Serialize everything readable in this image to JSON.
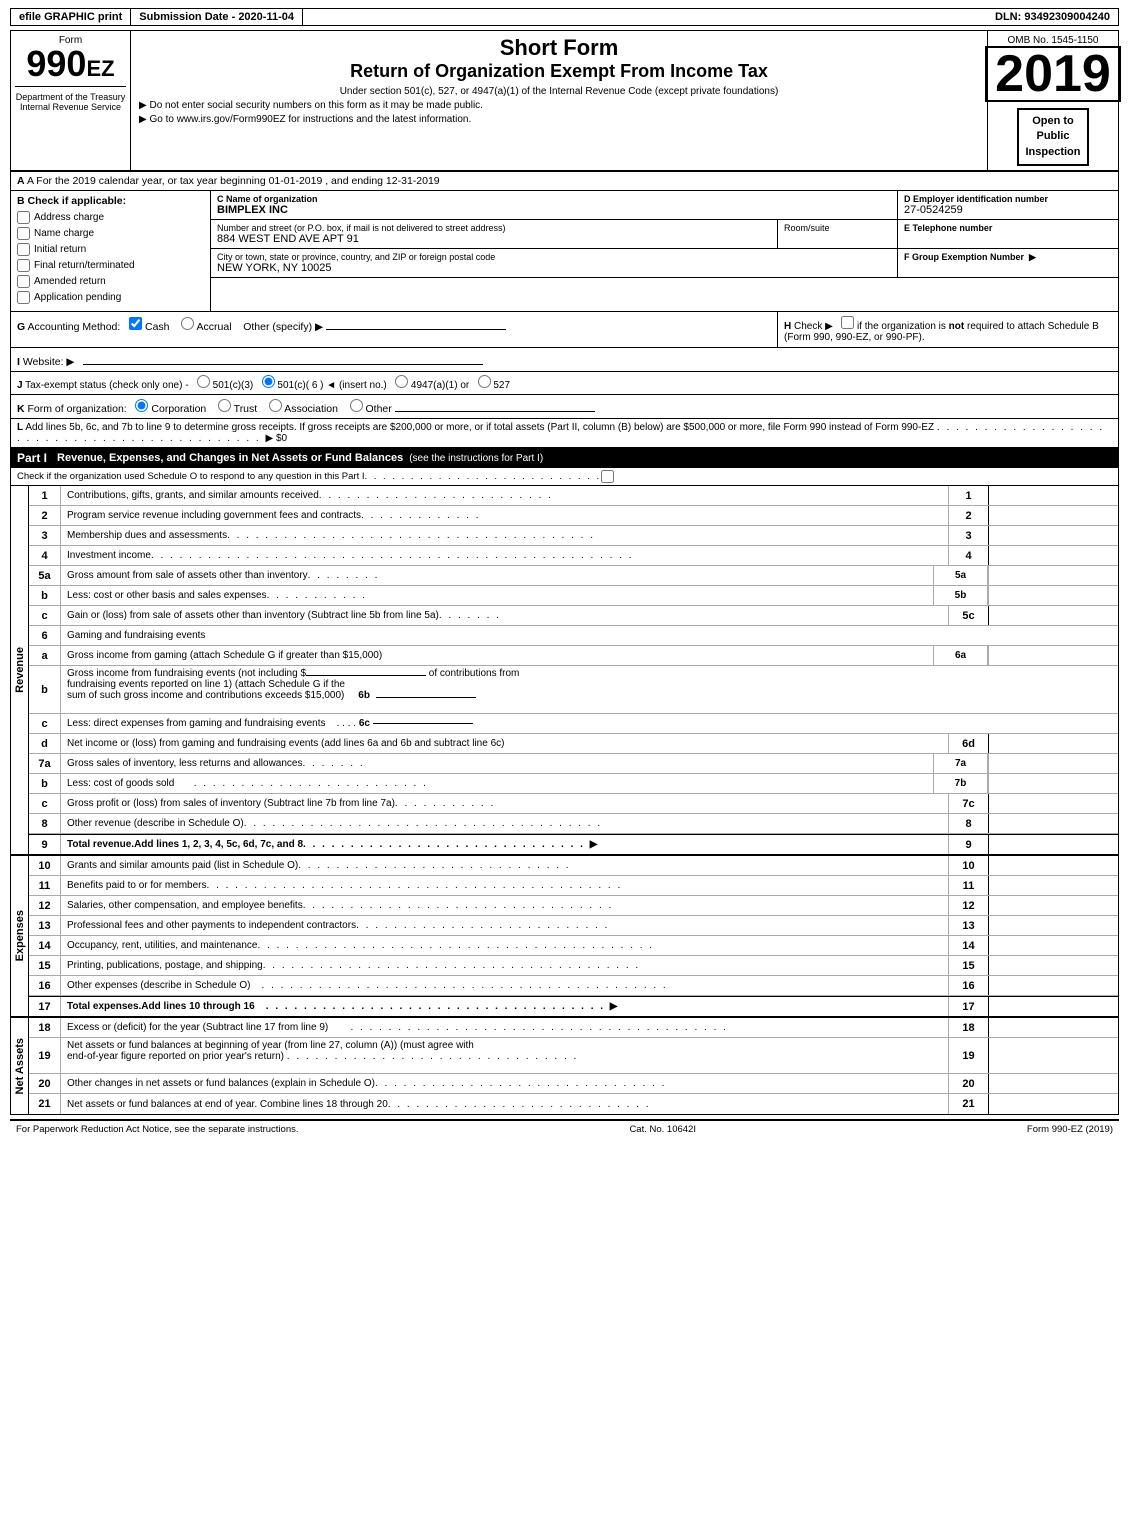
{
  "topBar": {
    "efile": "efile GRAPHIC print",
    "submission": "Submission Date - 2020-11-04",
    "dln": "DLN: 93492309004240"
  },
  "header": {
    "formLabel": "Form",
    "formNumber": "990",
    "formEZ": "EZ",
    "shortForm": "Short Form",
    "returnTitle": "Return of Organization Exempt From Income Tax",
    "underSection": "Under section 501(c), 527, or 4947(a)(1) of the Internal Revenue Code (except private foundations)",
    "doNotEnter": "▶ Do not enter social security numbers on this form as it may be made public.",
    "goTo": "▶ Go to www.irs.gov/Form990EZ for instructions and the latest information.",
    "ombNo": "OMB No. 1545-1150",
    "year": "2019",
    "openToPublic": "Open to\nPublic\nInspection"
  },
  "sectionA": {
    "text": "A For the 2019 calendar year, or tax year beginning 01-01-2019 , and ending 12-31-2019"
  },
  "sectionB": {
    "label": "B Check if applicable:",
    "checkboxes": [
      {
        "id": "address-change",
        "label": "Address change",
        "checked": false
      },
      {
        "id": "name-change",
        "label": "Name change",
        "checked": false
      },
      {
        "id": "initial-return",
        "label": "Initial return",
        "checked": false
      },
      {
        "id": "final-return",
        "label": "Final return/terminated",
        "checked": false
      },
      {
        "id": "amended-return",
        "label": "Amended return",
        "checked": false
      },
      {
        "id": "application-pending",
        "label": "Application pending",
        "checked": false
      }
    ]
  },
  "sectionC": {
    "label": "C Name of organization",
    "value": "BIMPLEX INC"
  },
  "sectionD": {
    "label": "D Employer identification number",
    "value": "27-0524259"
  },
  "sectionStreet": {
    "label": "Number and street (or P.O. box, if mail is not delivered to street address)",
    "value": "884 WEST END AVE APT 91",
    "roomLabel": "Room/suite",
    "roomValue": ""
  },
  "sectionE": {
    "label": "E Telephone number",
    "value": ""
  },
  "sectionCity": {
    "label": "City or town, state or province, country, and ZIP or foreign postal code",
    "value": "NEW YORK, NY  10025"
  },
  "sectionF": {
    "label": "F Group Exemption Number",
    "arrowLabel": "▶",
    "value": ""
  },
  "sectionG": {
    "label": "G Accounting Method:",
    "cashLabel": "☑ Cash",
    "accrualLabel": "○ Accrual",
    "otherLabel": "Other (specify) ▶",
    "underline": ""
  },
  "sectionH": {
    "label": "H Check ▶",
    "text": "○ if the organization is not required to attach Schedule B (Form 990, 990-EZ, or 990-PF)."
  },
  "sectionI": {
    "label": "I Website: ▶",
    "value": ""
  },
  "sectionJ": {
    "label": "J Tax-exempt status (check only one) -",
    "options": "○ 501(c)(3)  ☑ 501(c)( 6 )  ◄ (insert no.)  ○ 4947(a)(1) or  ○ 527"
  },
  "sectionK": {
    "label": "K Form of organization:",
    "options": "☑ Corporation   ○ Trust   ○ Association   ○ Other"
  },
  "sectionL": {
    "text": "L Add lines 5b, 6c, and 7b to line 9 to determine gross receipts. If gross receipts are $200,000 or more, or if total assets (Part II, column (B) below) are $500,000 or more, file Form 990 instead of Form 990-EZ",
    "dots": ". . . . . . . . . . . . . . . . . . . . . . . . . . . . . . . . . . . . . . . . . . . ▶ $0"
  },
  "partI": {
    "label": "Part I",
    "title": "Revenue, Expenses, and Changes in Net Assets or Fund Balances",
    "seeInstructions": "(see the instructions for Part I)",
    "checkSchedule": "Check if the organization used Schedule O to respond to any question in this Part I",
    "checkDots": ". . . . . . . . . . . . . . . . . . . . . . . . . . ○",
    "revenueSideLabel": "Revenue",
    "lines": [
      {
        "num": "1",
        "desc": "Contributions, gifts, grants, and similar amounts received",
        "dots": ". . . . . . . . . . . . . . . . . . . . . . . . .",
        "ref": "",
        "lineNum": "1",
        "bold": false
      },
      {
        "num": "2",
        "desc": "Program service revenue including government fees and contracts",
        "dots": ". . . . . . . . . . . . . .",
        "ref": "",
        "lineNum": "2",
        "bold": false
      },
      {
        "num": "3",
        "desc": "Membership dues and assessments",
        "dots": ". . . . . . . . . . . . . . . . . . . . . . . . . . . . . . . . . . . . . . .",
        "ref": "",
        "lineNum": "3",
        "bold": false
      },
      {
        "num": "4",
        "desc": "Investment income",
        "dots": ". . . . . . . . . . . . . . . . . . . . . . . . . . . . . . . . . . . . . . . . . . . . . . . . . . .",
        "ref": "",
        "lineNum": "4",
        "bold": false
      },
      {
        "num": "5a",
        "desc": "Gross amount from sale of assets other than inventory",
        "dots": ". . . . . . . .",
        "ref": "5a",
        "lineNum": "",
        "bold": false
      },
      {
        "num": "b",
        "desc": "Less: cost or other basis and sales expenses",
        "dots": ". . . . . . . . . . .",
        "ref": "5b",
        "lineNum": "",
        "bold": false
      },
      {
        "num": "c",
        "desc": "Gain or (loss) from sale of assets other than inventory (Subtract line 5b from line 5a)",
        "dots": ". . . . . . .",
        "ref": "",
        "lineNum": "5c",
        "bold": false
      }
    ],
    "line6": {
      "num": "6",
      "desc": "Gaming and fundraising events"
    },
    "line6a": {
      "num": "a",
      "desc": "Gross income from gaming (attach Schedule G if greater than $15,000)",
      "ref": "6a"
    },
    "line6b": {
      "num": "b",
      "desc": "Gross income from fundraising events (not including $",
      "descCont": "of contributions from fundraising events reported on line 1) (attach Schedule G if the sum of such gross income and contributions exceeds $15,000)",
      "ref": "6b"
    },
    "line6c": {
      "num": "c",
      "desc": "Less: direct expenses from gaming and fundraising events",
      "dots": ". . . .",
      "ref": "6c"
    },
    "line6d": {
      "num": "d",
      "desc": "Net income or (loss) from gaming and fundraising events (add lines 6a and 6b and subtract line 6c)",
      "lineNum": "6d"
    },
    "line7a": {
      "num": "7a",
      "desc": "Gross sales of inventory, less returns and allowances",
      "dots": ". . . . . .",
      "ref": "7a"
    },
    "line7b": {
      "num": "b",
      "desc": "Less: cost of goods sold",
      "dots": ". . . . . . . . . . . . . . . . . . . . . . . . .",
      "ref": "7b"
    },
    "line7c": {
      "num": "c",
      "desc": "Gross profit or (loss) from sales of inventory (Subtract line 7b from line 7a)",
      "dots": ". . . . . . . . . . .",
      "lineNum": "7c"
    },
    "line8": {
      "num": "8",
      "desc": "Other revenue (describe in Schedule O)",
      "dots": ". . . . . . . . . . . . . . . . . . . . . . . . . . . . . . . . . . . . . .",
      "lineNum": "8"
    },
    "line9": {
      "num": "9",
      "desc": "Total revenue. Add lines 1, 2, 3, 4, 5c, 6d, 7c, and 8",
      "dots": ". . . . . . . . . . . . . . . . . . . . . . . . . . . . . . ▶",
      "lineNum": "9",
      "bold": true
    }
  },
  "partIExpenses": {
    "expensesSideLabel": "Expenses",
    "lines": [
      {
        "num": "10",
        "desc": "Grants and similar amounts paid (list in Schedule O)",
        "dots": ". . . . . . . . . . . . . . . . . . . . . . . . . . . . .",
        "lineNum": "10"
      },
      {
        "num": "11",
        "desc": "Benefits paid to or for members",
        "dots": ". . . . . . . . . . . . . . . . . . . . . . . . . . . . . . . . . . . . . . . . . . . . .",
        "lineNum": "11"
      },
      {
        "num": "12",
        "desc": "Salaries, other compensation, and employee benefits",
        "dots": ". . . . . . . . . . . . . . . . . . . . . . . . . . . . . . . . .",
        "lineNum": "12"
      },
      {
        "num": "13",
        "desc": "Professional fees and other payments to independent contractors",
        "dots": ". . . . . . . . . . . . . . . . . . . . . . . . . . .",
        "lineNum": "13"
      },
      {
        "num": "14",
        "desc": "Occupancy, rent, utilities, and maintenance",
        "dots": ". . . . . . . . . . . . . . . . . . . . . . . . . . . . . . . . . . . . . . . . . .",
        "lineNum": "14"
      },
      {
        "num": "15",
        "desc": "Printing, publications, postage, and shipping.",
        "dots": ". . . . . . . . . . . . . . . . . . . . . . . . . . . . . . . . . . . . . . . .",
        "lineNum": "15"
      },
      {
        "num": "16",
        "desc": "Other expenses (describe in Schedule O)",
        "dots": ". . . . . . . . . . . . . . . . . . . . . . . . . . . . . . . . . . . . . . . . . . .",
        "lineNum": "16"
      },
      {
        "num": "17",
        "desc": "Total expenses. Add lines 10 through 16",
        "dots": ". . . . . . . . . . . . . . . . . . . . . . . . . . . . . . . . . . . . ▶",
        "lineNum": "17",
        "bold": true
      }
    ]
  },
  "partINetAssets": {
    "netAssetsSideLabel": "Net Assets",
    "lines": [
      {
        "num": "18",
        "desc": "Excess or (deficit) for the year (Subtract line 17 from line 9)",
        "dots": ". . . . . . . . . . . . . . . . . . . . . . . . . . . . . . . . . . . . . . . .",
        "lineNum": "18"
      },
      {
        "num": "19",
        "desc": "Net assets or fund balances at beginning of year (from line 27, column (A)) (must agree with end-of-year figure reported on prior year's return)",
        "dots": ". . . . . . . . . . . . . . . . . . . . . . . . . . . . . . . .",
        "lineNum": "19"
      },
      {
        "num": "20",
        "desc": "Other changes in net assets or fund balances (explain in Schedule O)",
        "dots": ". . . . . . . . . . . . . . . . . . . . . . . . . . . . . . . .",
        "lineNum": "20"
      },
      {
        "num": "21",
        "desc": "Net assets or fund balances at end of year. Combine lines 18 through 20",
        "dots": ". . . . . . . . . . . . . . . . . . . . . . . . . . . . .",
        "lineNum": "21"
      }
    ]
  },
  "footer": {
    "paperwork": "For Paperwork Reduction Act Notice, see the separate instructions.",
    "catNo": "Cat. No. 10642I",
    "formRef": "Form 990-EZ (2019)"
  }
}
